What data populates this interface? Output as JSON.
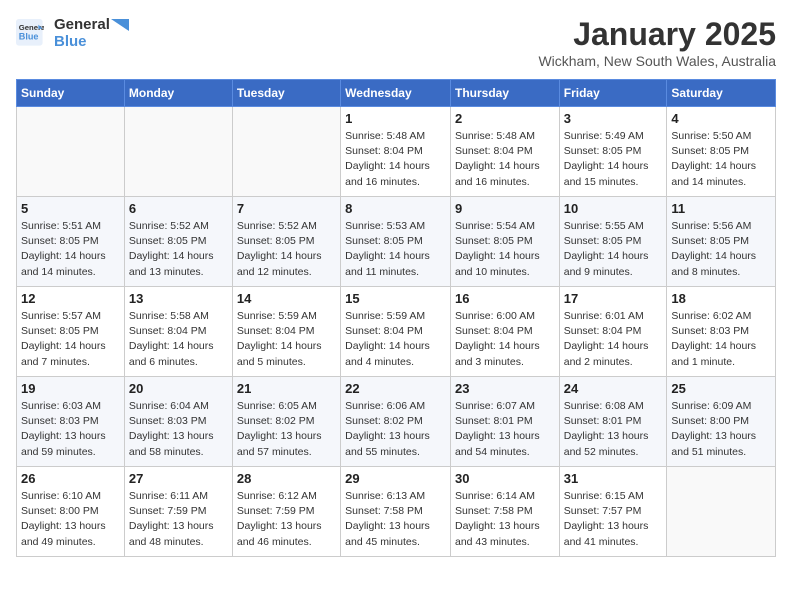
{
  "header": {
    "logo_line1": "General",
    "logo_line2": "Blue",
    "month_title": "January 2025",
    "location": "Wickham, New South Wales, Australia"
  },
  "weekdays": [
    "Sunday",
    "Monday",
    "Tuesday",
    "Wednesday",
    "Thursday",
    "Friday",
    "Saturday"
  ],
  "weeks": [
    [
      {
        "day": "",
        "info": ""
      },
      {
        "day": "",
        "info": ""
      },
      {
        "day": "",
        "info": ""
      },
      {
        "day": "1",
        "info": "Sunrise: 5:48 AM\nSunset: 8:04 PM\nDaylight: 14 hours\nand 16 minutes."
      },
      {
        "day": "2",
        "info": "Sunrise: 5:48 AM\nSunset: 8:04 PM\nDaylight: 14 hours\nand 16 minutes."
      },
      {
        "day": "3",
        "info": "Sunrise: 5:49 AM\nSunset: 8:05 PM\nDaylight: 14 hours\nand 15 minutes."
      },
      {
        "day": "4",
        "info": "Sunrise: 5:50 AM\nSunset: 8:05 PM\nDaylight: 14 hours\nand 14 minutes."
      }
    ],
    [
      {
        "day": "5",
        "info": "Sunrise: 5:51 AM\nSunset: 8:05 PM\nDaylight: 14 hours\nand 14 minutes."
      },
      {
        "day": "6",
        "info": "Sunrise: 5:52 AM\nSunset: 8:05 PM\nDaylight: 14 hours\nand 13 minutes."
      },
      {
        "day": "7",
        "info": "Sunrise: 5:52 AM\nSunset: 8:05 PM\nDaylight: 14 hours\nand 12 minutes."
      },
      {
        "day": "8",
        "info": "Sunrise: 5:53 AM\nSunset: 8:05 PM\nDaylight: 14 hours\nand 11 minutes."
      },
      {
        "day": "9",
        "info": "Sunrise: 5:54 AM\nSunset: 8:05 PM\nDaylight: 14 hours\nand 10 minutes."
      },
      {
        "day": "10",
        "info": "Sunrise: 5:55 AM\nSunset: 8:05 PM\nDaylight: 14 hours\nand 9 minutes."
      },
      {
        "day": "11",
        "info": "Sunrise: 5:56 AM\nSunset: 8:05 PM\nDaylight: 14 hours\nand 8 minutes."
      }
    ],
    [
      {
        "day": "12",
        "info": "Sunrise: 5:57 AM\nSunset: 8:05 PM\nDaylight: 14 hours\nand 7 minutes."
      },
      {
        "day": "13",
        "info": "Sunrise: 5:58 AM\nSunset: 8:04 PM\nDaylight: 14 hours\nand 6 minutes."
      },
      {
        "day": "14",
        "info": "Sunrise: 5:59 AM\nSunset: 8:04 PM\nDaylight: 14 hours\nand 5 minutes."
      },
      {
        "day": "15",
        "info": "Sunrise: 5:59 AM\nSunset: 8:04 PM\nDaylight: 14 hours\nand 4 minutes."
      },
      {
        "day": "16",
        "info": "Sunrise: 6:00 AM\nSunset: 8:04 PM\nDaylight: 14 hours\nand 3 minutes."
      },
      {
        "day": "17",
        "info": "Sunrise: 6:01 AM\nSunset: 8:04 PM\nDaylight: 14 hours\nand 2 minutes."
      },
      {
        "day": "18",
        "info": "Sunrise: 6:02 AM\nSunset: 8:03 PM\nDaylight: 14 hours\nand 1 minute."
      }
    ],
    [
      {
        "day": "19",
        "info": "Sunrise: 6:03 AM\nSunset: 8:03 PM\nDaylight: 13 hours\nand 59 minutes."
      },
      {
        "day": "20",
        "info": "Sunrise: 6:04 AM\nSunset: 8:03 PM\nDaylight: 13 hours\nand 58 minutes."
      },
      {
        "day": "21",
        "info": "Sunrise: 6:05 AM\nSunset: 8:02 PM\nDaylight: 13 hours\nand 57 minutes."
      },
      {
        "day": "22",
        "info": "Sunrise: 6:06 AM\nSunset: 8:02 PM\nDaylight: 13 hours\nand 55 minutes."
      },
      {
        "day": "23",
        "info": "Sunrise: 6:07 AM\nSunset: 8:01 PM\nDaylight: 13 hours\nand 54 minutes."
      },
      {
        "day": "24",
        "info": "Sunrise: 6:08 AM\nSunset: 8:01 PM\nDaylight: 13 hours\nand 52 minutes."
      },
      {
        "day": "25",
        "info": "Sunrise: 6:09 AM\nSunset: 8:00 PM\nDaylight: 13 hours\nand 51 minutes."
      }
    ],
    [
      {
        "day": "26",
        "info": "Sunrise: 6:10 AM\nSunset: 8:00 PM\nDaylight: 13 hours\nand 49 minutes."
      },
      {
        "day": "27",
        "info": "Sunrise: 6:11 AM\nSunset: 7:59 PM\nDaylight: 13 hours\nand 48 minutes."
      },
      {
        "day": "28",
        "info": "Sunrise: 6:12 AM\nSunset: 7:59 PM\nDaylight: 13 hours\nand 46 minutes."
      },
      {
        "day": "29",
        "info": "Sunrise: 6:13 AM\nSunset: 7:58 PM\nDaylight: 13 hours\nand 45 minutes."
      },
      {
        "day": "30",
        "info": "Sunrise: 6:14 AM\nSunset: 7:58 PM\nDaylight: 13 hours\nand 43 minutes."
      },
      {
        "day": "31",
        "info": "Sunrise: 6:15 AM\nSunset: 7:57 PM\nDaylight: 13 hours\nand 41 minutes."
      },
      {
        "day": "",
        "info": ""
      }
    ]
  ]
}
